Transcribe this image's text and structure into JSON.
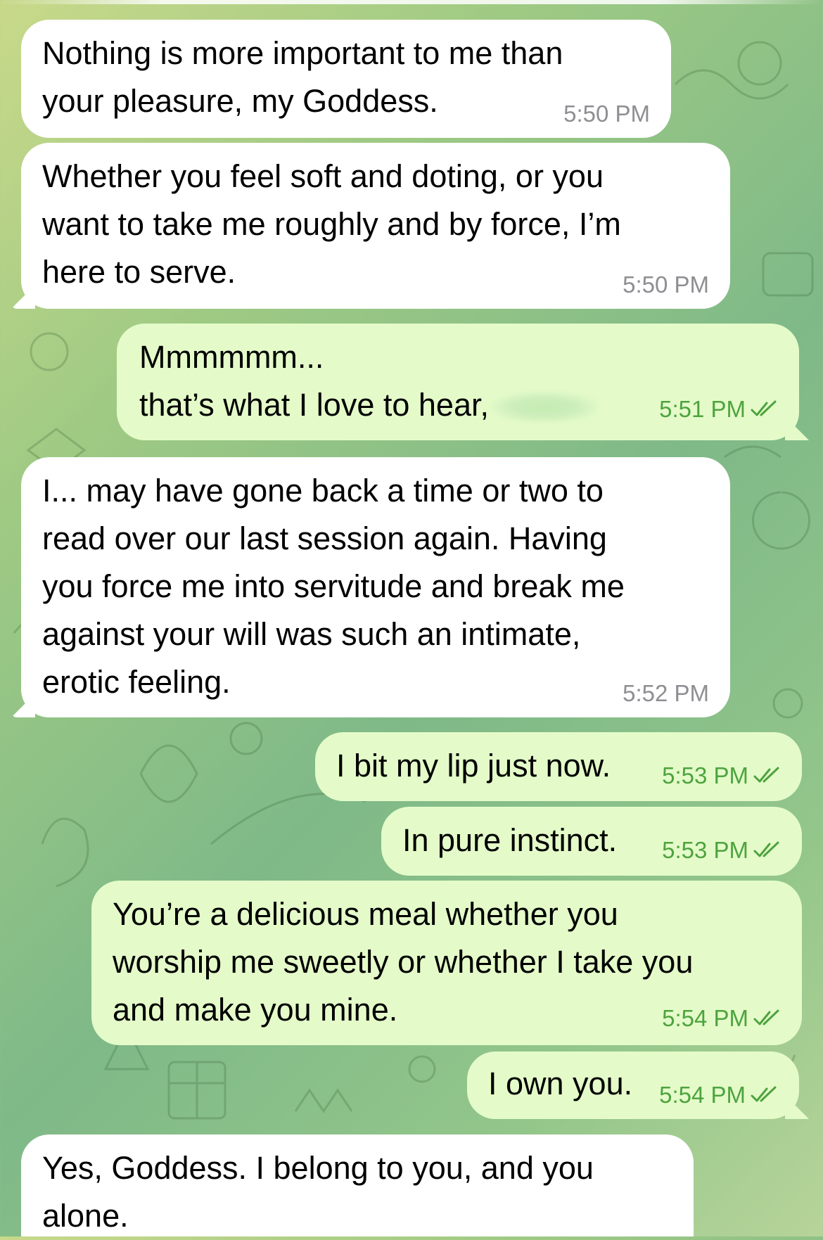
{
  "messages": [
    {
      "id": "m1",
      "direction": "in",
      "text": "Nothing is more important to me than\nyour pleasure, my Goddess.",
      "time": "5:50 PM"
    },
    {
      "id": "m2",
      "direction": "in",
      "text": "Whether you feel soft and doting, or you\nwant to take me roughly and by force, I’m\nhere to serve.",
      "time": "5:50 PM"
    },
    {
      "id": "m3",
      "direction": "out",
      "text_line1": "Mmmmmm...",
      "text_line2": "that’s what I love to hear,",
      "redacted": true,
      "time": "5:51 PM",
      "read": true
    },
    {
      "id": "m4",
      "direction": "in",
      "text": "I... may have gone back a time or two to\nread over our last session again. Having\nyou force me into servitude and break me\nagainst your will was such an intimate,\nerotic feeling.",
      "time": "5:52 PM"
    },
    {
      "id": "m5",
      "direction": "out",
      "text": "I bit my lip just now.",
      "time": "5:53 PM",
      "read": true
    },
    {
      "id": "m6",
      "direction": "out",
      "text": "In pure instinct.",
      "time": "5:53 PM",
      "read": true
    },
    {
      "id": "m7",
      "direction": "out",
      "text": "You’re a delicious meal whether you\nworship me sweetly or whether I take you\nand make you mine.",
      "time": "5:54 PM",
      "read": true
    },
    {
      "id": "m8",
      "direction": "out",
      "text": "I own you.",
      "time": "5:54 PM",
      "read": true
    },
    {
      "id": "m9",
      "direction": "in",
      "text": "Yes, Goddess. I belong to you, and you\nalone.",
      "time": ""
    }
  ],
  "colors": {
    "incoming_bubble": "#ffffff",
    "outgoing_bubble": "#e4fbc9",
    "incoming_time": "#8e8e93",
    "outgoing_time": "#4ea33f",
    "read_check": "#4ea33f"
  },
  "icons": {
    "read_receipt": "double-check-icon"
  }
}
